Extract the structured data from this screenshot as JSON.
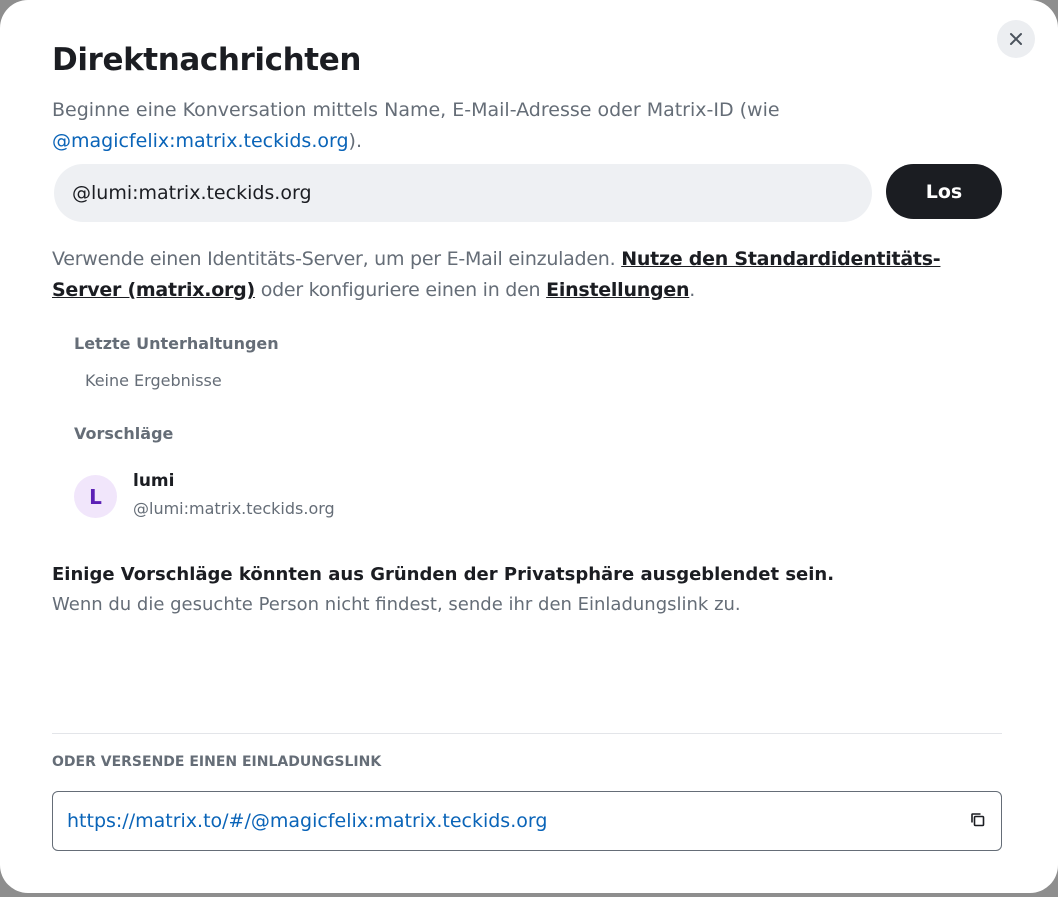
{
  "dialog": {
    "title": "Direktnachrichten",
    "intro_text": "Beginne eine Konversation mittels Name, E-Mail-Adresse oder Matrix-ID (wie",
    "intro_link": "@magicfelix:matrix.teckids.org",
    "intro_end": ").",
    "close_icon": "close-icon"
  },
  "search": {
    "value": "@lumi:matrix.teckids.org",
    "go_label": "Los"
  },
  "identity": {
    "text_before": "Verwende einen Identitäts-Server, um per E-Mail einzuladen.",
    "default_server_link": "Nutze den Standardidentitäts-Server (matrix.org)",
    "text_middle": "oder konfiguriere einen in den",
    "settings_link": "Einstellungen",
    "text_end": "."
  },
  "recent": {
    "heading": "Letzte Unterhaltungen",
    "empty": "Keine Ergebnisse"
  },
  "suggestions": {
    "heading": "Vorschläge",
    "items": [
      {
        "avatar_letter": "L",
        "name": "lumi",
        "id": "@lumi:matrix.teckids.org"
      }
    ]
  },
  "privacy": {
    "title": "Einige Vorschläge könnten aus Gründen der Privatsphäre ausgeblendet sein.",
    "text": "Wenn du die gesuchte Person nicht findest, sende ihr den Einladungslink zu."
  },
  "invite": {
    "heading": "ODER VERSENDE EINEN EINLADUNGSLINK",
    "link": "https://matrix.to/#/@magicfelix:matrix.teckids.org",
    "copy_icon": "copy-icon"
  },
  "colors": {
    "primary_text": "#1b1d22",
    "secondary_text": "#656d77",
    "link": "#0a64b8",
    "avatar_bg": "#f1e6fb",
    "avatar_fg": "#5b20b5"
  }
}
